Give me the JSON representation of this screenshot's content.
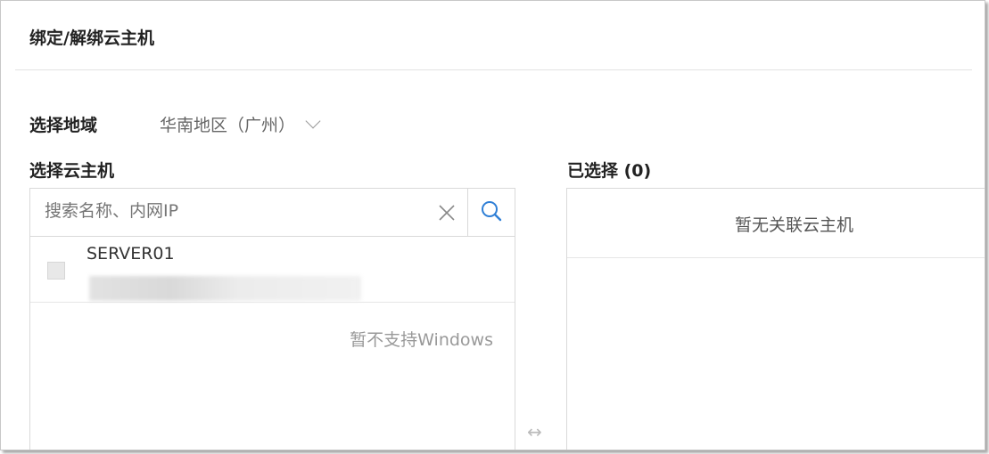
{
  "dialog": {
    "title": "绑定/解绑云主机"
  },
  "region": {
    "label": "选择地域",
    "selected": "华南地区（广州）"
  },
  "vm_picker": {
    "label": "选择云主机",
    "search_placeholder": "搜索名称、内网IP",
    "items": [
      {
        "name": "SERVER01"
      }
    ],
    "note": "暂不支持Windows"
  },
  "selected": {
    "label": "已选择 (0)",
    "empty_text": "暂无关联云主机"
  },
  "icons": {
    "clear": "close-icon",
    "search": "search-icon",
    "swap": "swap-arrows-icon",
    "region_dropdown": "chevron-down-icon"
  },
  "colors": {
    "accent": "#2f7fd6",
    "border": "#d9d9d9"
  }
}
